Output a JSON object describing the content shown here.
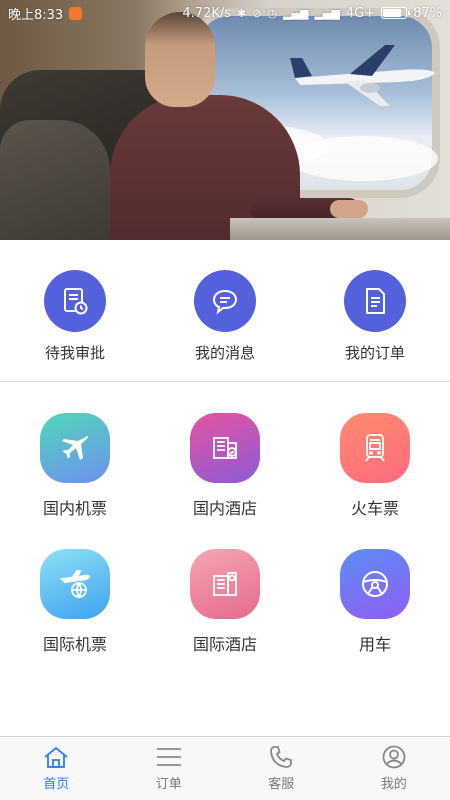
{
  "status_bar": {
    "time": "晚上8:33",
    "network_speed": "4.72K/s",
    "network_type": "4G+",
    "battery_percent": "87%",
    "battery_level": 0.87
  },
  "quick_actions": [
    {
      "label": "待我审批",
      "icon": "approval-clock-icon"
    },
    {
      "label": "我的消息",
      "icon": "chat-bubble-icon"
    },
    {
      "label": "我的订单",
      "icon": "order-document-icon"
    }
  ],
  "services": [
    {
      "label": "国内机票",
      "icon": "airplane-icon",
      "gradient": [
        "#4fd8b8",
        "#6f8ff0"
      ]
    },
    {
      "label": "国内酒店",
      "icon": "hotel-icon",
      "gradient": [
        "#e553a0",
        "#8d5bd8"
      ]
    },
    {
      "label": "火车票",
      "icon": "train-icon",
      "gradient": [
        "#ff8a6e",
        "#ff6b7f"
      ]
    },
    {
      "label": "国际机票",
      "icon": "globe-airplane-icon",
      "gradient": [
        "#8fe0f5",
        "#3da2ef"
      ]
    },
    {
      "label": "国际酒店",
      "icon": "building-icon",
      "gradient": [
        "#f4a6b4",
        "#e66a8a"
      ]
    },
    {
      "label": "用车",
      "icon": "steering-wheel-icon",
      "gradient": [
        "#5c8cf4",
        "#8f5ef3"
      ]
    }
  ],
  "tabs": [
    {
      "label": "首页",
      "icon": "home-icon",
      "active": true
    },
    {
      "label": "订单",
      "icon": "list-icon",
      "active": false
    },
    {
      "label": "客服",
      "icon": "phone-icon",
      "active": false
    },
    {
      "label": "我的",
      "icon": "user-icon",
      "active": false
    }
  ],
  "colors": {
    "primary": "#5560dd",
    "tab_active": "#2a7ff0",
    "tab_inactive": "#777777"
  }
}
